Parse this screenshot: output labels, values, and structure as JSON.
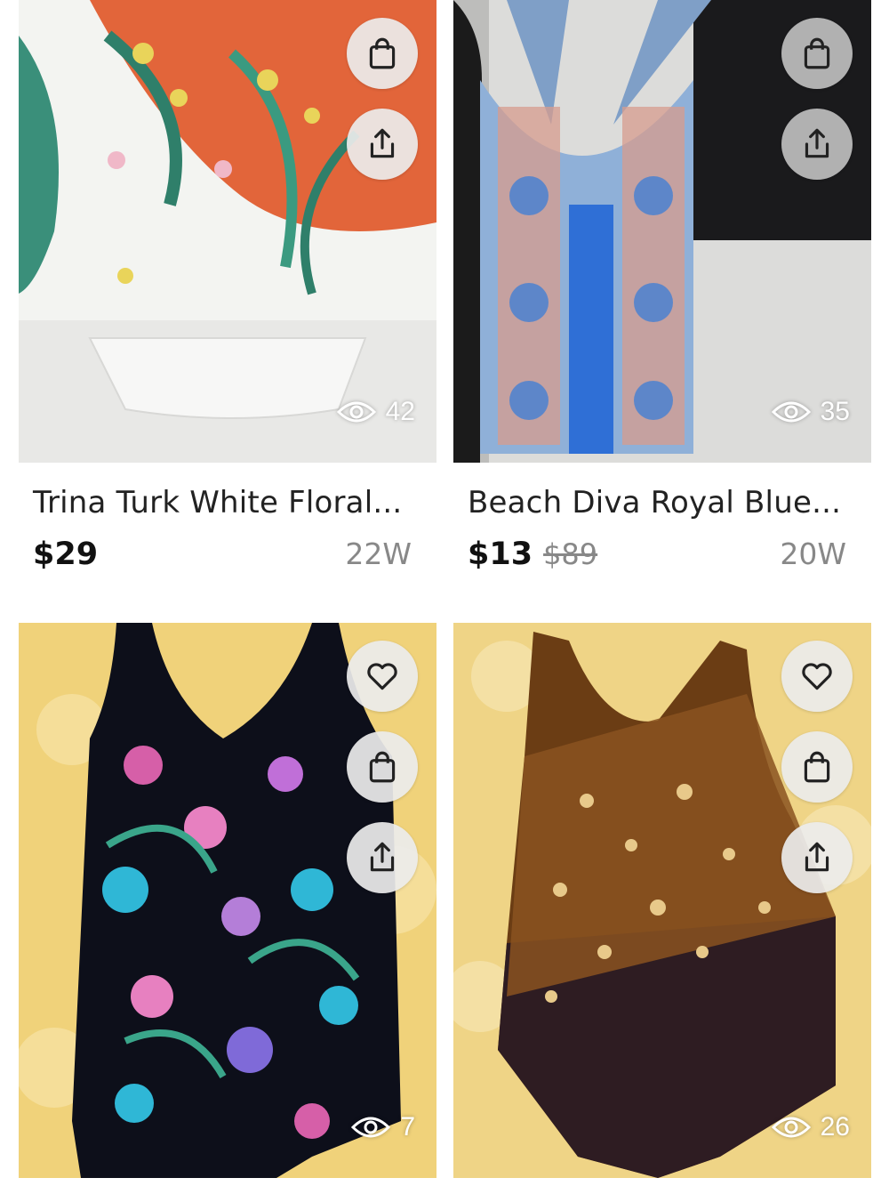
{
  "listings": [
    {
      "title": "Trina Turk White Floral...",
      "price": "$29",
      "original_price": "",
      "size": "22W",
      "views": "42",
      "actions": [
        "bag-icon",
        "share-icon"
      ]
    },
    {
      "title": "Beach Diva Royal Blue...",
      "price": "$13",
      "original_price": "$89",
      "size": "20W",
      "views": "35",
      "actions": [
        "bag-icon",
        "share-icon"
      ]
    },
    {
      "title": "",
      "price": "",
      "original_price": "",
      "size": "",
      "views": "7",
      "actions": [
        "heart-icon",
        "bag-icon",
        "share-icon"
      ]
    },
    {
      "title": "",
      "price": "",
      "original_price": "",
      "size": "",
      "views": "26",
      "actions": [
        "heart-icon",
        "bag-icon",
        "share-icon"
      ]
    }
  ],
  "colors": {
    "overlay_button": "#ebebeb",
    "price": "#111111",
    "muted": "#888888"
  }
}
